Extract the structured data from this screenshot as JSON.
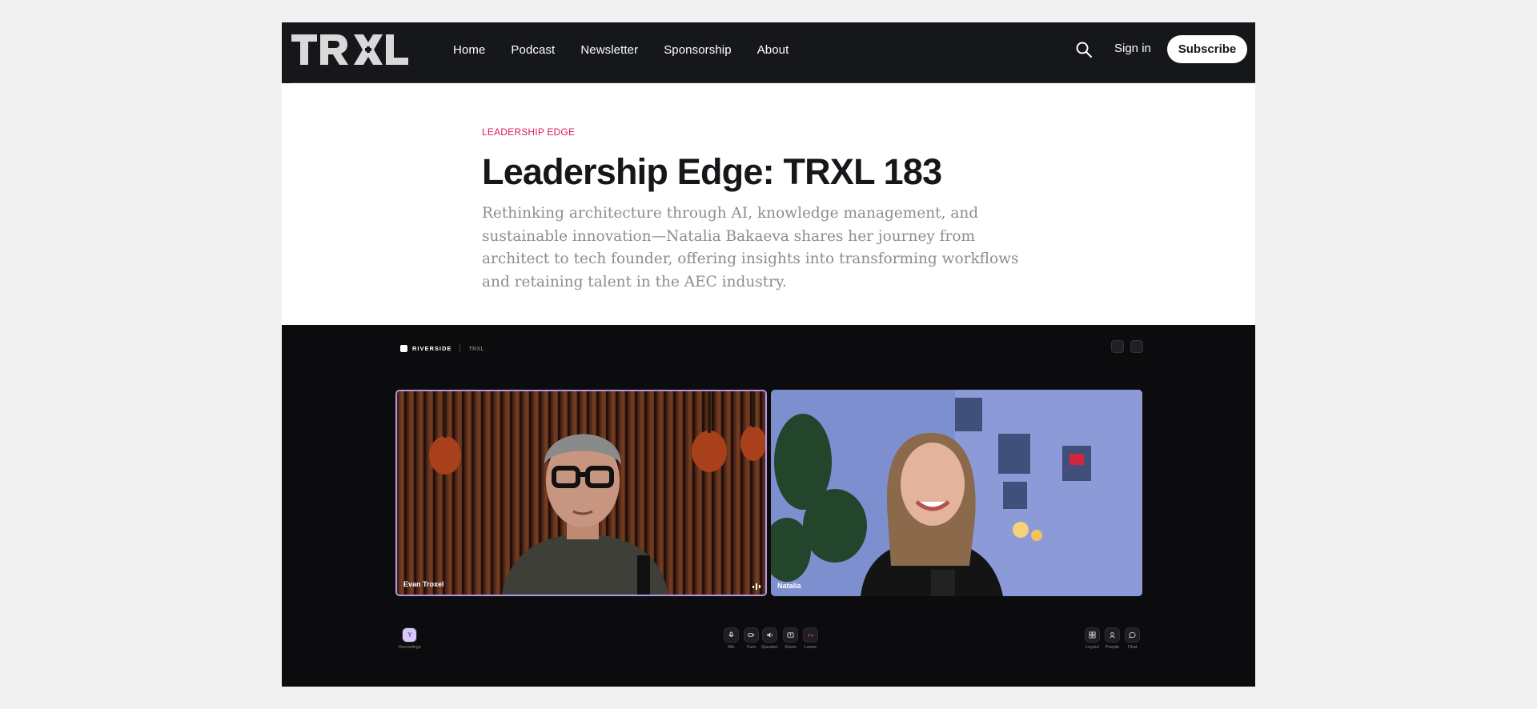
{
  "header": {
    "logo_text": "TRXL",
    "nav": [
      "Home",
      "Podcast",
      "Newsletter",
      "Sponsorship",
      "About"
    ],
    "signin_label": "Sign in",
    "subscribe_label": "Subscribe",
    "search_icon": "search-icon"
  },
  "article": {
    "tag": "Leadership Edge",
    "title": "Leadership Edge: TRXL 183",
    "excerpt": "Rethinking architecture through AI, knowledge management, and sustainable innovation—Natalia Bakaeva shares her journey from architect to tech founder, offering insights into transforming workflows and retaining talent in the AEC industry."
  },
  "feature_image": {
    "app_name": "RIVERSIDE",
    "project": "TRXL",
    "participants": [
      {
        "name": "Evan Troxel",
        "speaking": true
      },
      {
        "name": "Natalia",
        "speaking": false
      }
    ],
    "left_controls": [
      {
        "label": "Recordings",
        "initial": "Y"
      }
    ],
    "center_controls": [
      "Mic",
      "Cam",
      "Speaker",
      "Share",
      "Leave"
    ],
    "right_controls": [
      "Layout",
      "People",
      "Chat"
    ],
    "colors": {
      "active_border": "#b296e6",
      "leave": "#e5484d",
      "background": "#0c0c0e"
    }
  },
  "colors": {
    "header_bg": "#15171a",
    "tag_accent": "#e0195c",
    "page_bg": "#f1f1f1"
  }
}
